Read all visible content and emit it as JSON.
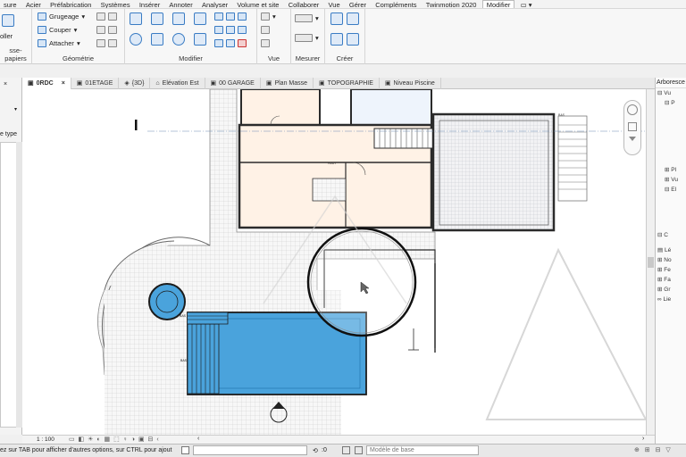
{
  "menu": [
    "sure",
    "Acier",
    "Préfabrication",
    "Systèmes",
    "Insérer",
    "Annoter",
    "Analyser",
    "Volume et site",
    "Collaborer",
    "Vue",
    "Gérer",
    "Compléments",
    "Twinmotion 2020",
    "Modifier"
  ],
  "ribbon": {
    "clipboard_label": "sse-papiers",
    "clipboard_item": "oller",
    "geometry": {
      "label": "Géométrie",
      "grugeage": "Grugeage",
      "couper": "Couper",
      "attacher": "Attacher"
    },
    "modify_label": "Modifier",
    "view_label": "Vue",
    "measure_label": "Mesurer",
    "create_label": "Créer"
  },
  "tabs": [
    {
      "label": "0RDC",
      "close": "×"
    },
    {
      "label": "01ETAGE"
    },
    {
      "label": "{3D}"
    },
    {
      "label": "Elévation Est"
    },
    {
      "label": "00 GARAGE"
    },
    {
      "label": "Plan Masse"
    },
    {
      "label": "TOPOGRAPHIE"
    },
    {
      "label": "Niveau Piscine"
    }
  ],
  "left_panel": {
    "type_label": "e type"
  },
  "right_panel": {
    "title": "Arboresce",
    "items": [
      "Vu",
      "P",
      "Pl",
      "Vu",
      "El",
      "C",
      "Lé",
      "No",
      "Fe",
      "Fa",
      "Gr",
      "Lie"
    ]
  },
  "floorplan_labels": {
    "bas1": "BAS",
    "bas2": "BAS",
    "bas3": "BAS",
    "haut": "HAUT"
  },
  "view_bar": {
    "scale": "1 : 100"
  },
  "status_bar": {
    "hint": "ez sur TAB pour afficher d'autres options, sur CTRL pour ajout",
    "count": ":0",
    "model": "Modèle de base"
  },
  "colors": {
    "pool": "#4aa3dc",
    "room": "#fff2e6",
    "wall": "#2b2b2b",
    "accent": "#3a7cc4"
  }
}
